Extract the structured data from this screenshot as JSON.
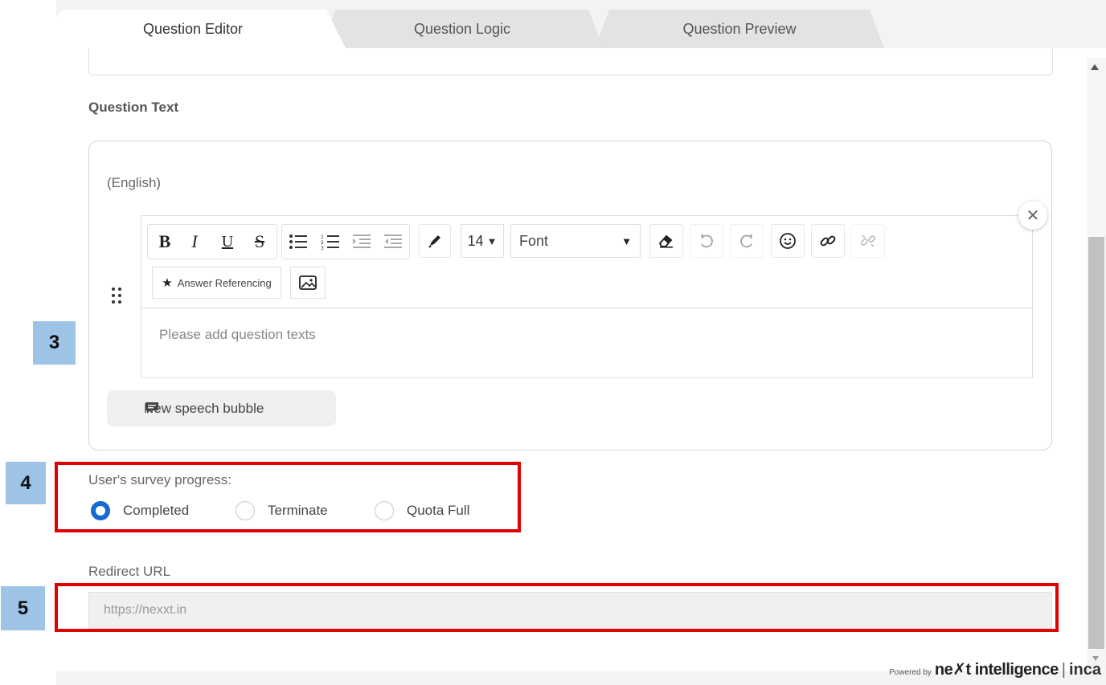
{
  "tabs": [
    {
      "label": "Question Editor",
      "active": true
    },
    {
      "label": "Question Logic",
      "active": false
    },
    {
      "label": "Question Preview",
      "active": false
    }
  ],
  "question_text": {
    "section_label": "Question Text",
    "language": "(English)",
    "toolbar": {
      "font_size": "14",
      "font": "Font",
      "answer_referencing": "Answer Referencing",
      "icons": [
        "bold-icon",
        "italic-icon",
        "underline-icon",
        "strikethrough-icon",
        "bullet-list-icon",
        "numbered-list-icon",
        "indent-icon",
        "outdent-icon",
        "pen-icon",
        "eraser-icon",
        "undo-icon",
        "redo-icon",
        "emoji-icon",
        "link-icon",
        "unlink-icon",
        "star-icon",
        "image-icon"
      ]
    },
    "placeholder": "Please add question texts",
    "speech_bubble_label": "New speech bubble"
  },
  "progress": {
    "label": "User's survey progress:",
    "options": [
      {
        "label": "Completed",
        "checked": true
      },
      {
        "label": "Terminate",
        "checked": false
      },
      {
        "label": "Quota Full",
        "checked": false
      }
    ]
  },
  "redirect": {
    "label": "Redirect URL",
    "placeholder": "https://nexxt.in"
  },
  "annotations": [
    "3",
    "4",
    "5"
  ],
  "footer": {
    "powered_by": "Powered by",
    "brand": "ne✗t intelligence",
    "separator": "|",
    "product": "inca"
  },
  "colors": {
    "accent": "#1669d1",
    "highlight": "#e00000",
    "badge": "#9dc3e6"
  }
}
